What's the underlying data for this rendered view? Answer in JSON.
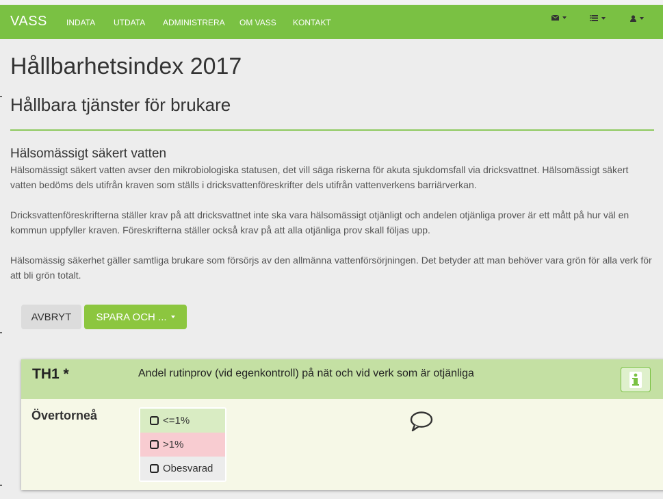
{
  "navbar": {
    "brand": "VASS",
    "items": [
      "INDATA",
      "UTDATA",
      "ADMINISTRERA",
      "OM VASS",
      "KONTAKT"
    ],
    "right_icons": [
      "envelope-icon",
      "list-icon",
      "user-icon"
    ]
  },
  "page": {
    "title": "Hållbarhetsindex 2017",
    "subtitle": "Hållbara tjänster för brukare"
  },
  "section": {
    "title": "Hälsomässigt säkert vatten",
    "paragraphs": [
      "Hälsomässigt säkert vatten avser den mikrobiologiska statusen, det vill säga riskerna för akuta sjukdomsfall via dricksvattnet. Hälsomässigt säkert vatten bedöms dels utifrån kraven som ställs i dricksvattenföreskrifter dels utifrån vattenverkens barriärverkan.",
      "Dricksvattenföreskrifterna ställer krav på att dricksvattnet inte ska vara hälsomässigt otjänligt och andelen otjänliga prover är ett mått på hur väl en kommun uppfyller kraven. Föreskrifterna ställer också krav på att alla otjänliga prov skall följas upp.",
      "Hälsomässig säkerhet gäller samtliga brukare som försörjs av den allmänna vattenförsörjningen. Det betyder att man behöver vara grön för alla verk för att bli grön totalt."
    ]
  },
  "actions": {
    "cancel": "AVBRYT",
    "save": "SPARA OCH ..."
  },
  "question": {
    "code": "TH1 *",
    "text": "Andel rutinprov (vid egenkontroll) på nät och vid verk som är otjänliga",
    "site": "Övertorneå",
    "options": [
      "<=1%",
      ">1%",
      "Obesvarad"
    ],
    "colors": {
      "good": "#d9ecc3",
      "bad": "#f8ccd1",
      "unanswered": "#ececec"
    }
  },
  "colors": {
    "brand_green": "#7ac143",
    "header_green": "#c4e0a3"
  }
}
